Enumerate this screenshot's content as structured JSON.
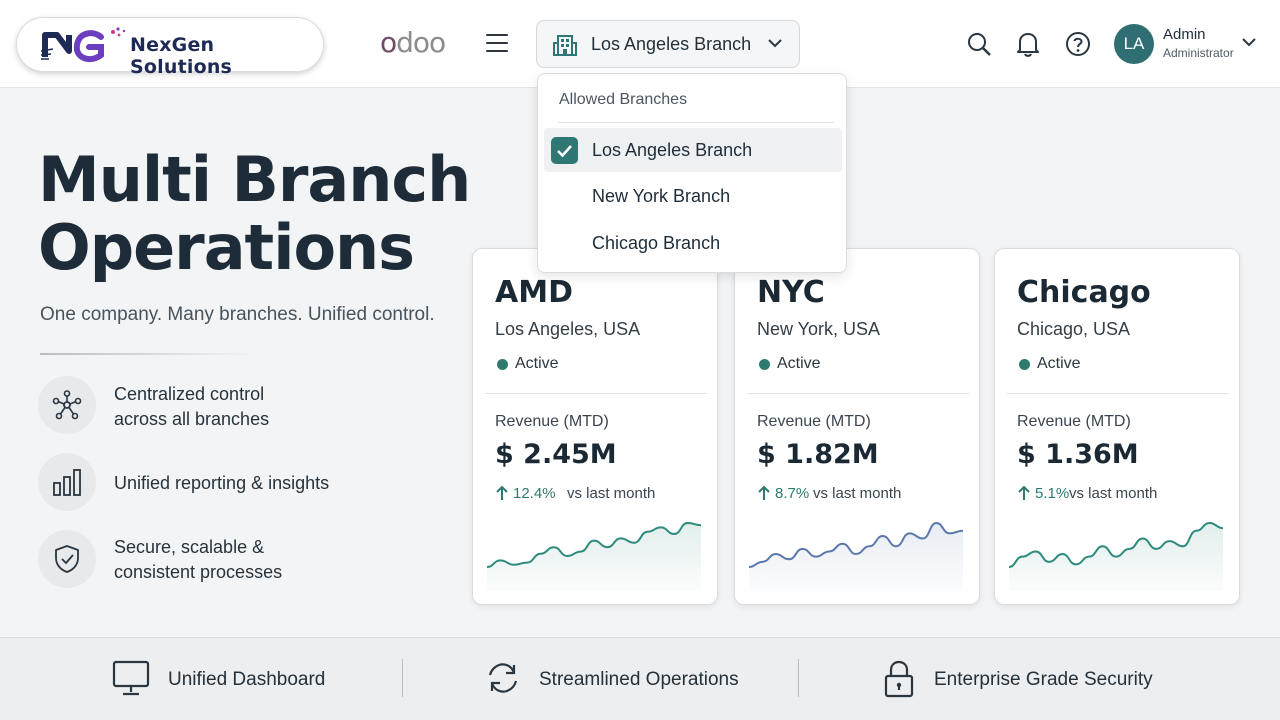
{
  "header": {
    "brand": "NexGen Solutions",
    "platform_logo": "odoo",
    "menu_icon": "hamburger-menu-icon",
    "branch_selector": {
      "icon": "building-icon",
      "value": "Los Angeles Branch"
    },
    "icons": [
      "search-icon",
      "bell-icon",
      "help-icon"
    ],
    "user": {
      "initials": "LA",
      "name": "Admin",
      "role": "Administrator"
    }
  },
  "branch_dropdown": {
    "heading": "Allowed Branches",
    "items": [
      {
        "label": "Los Angeles Branch",
        "checked": true
      },
      {
        "label": "New York Branch",
        "checked": false
      },
      {
        "label": "Chicago Branch",
        "checked": false
      }
    ]
  },
  "hero": {
    "title_line1": "Multi Branch",
    "title_line2": "Operations",
    "subtitle": "One company. Many branches. Unified control.",
    "features": [
      {
        "icon": "network-icon",
        "line1": "Centralized control",
        "line2": "across all branches"
      },
      {
        "icon": "bar-chart-icon",
        "line1": "Unified reporting & insights",
        "line2": ""
      },
      {
        "icon": "shield-check-icon",
        "line1": "Secure, scalable &",
        "line2": "consistent processes"
      }
    ]
  },
  "cards": [
    {
      "code": "AMD",
      "city": "Los Angeles, USA",
      "status": "Active",
      "rev_label": "Revenue (MTD)",
      "revenue": "$ 2.45M",
      "change": "12.4%",
      "vs": "vs last month",
      "line_color": "#2e8a7c",
      "spark": [
        10,
        13,
        11,
        12,
        16,
        19,
        15,
        17,
        22,
        19,
        23,
        21,
        26,
        28,
        25,
        30,
        29
      ]
    },
    {
      "code": "NYC",
      "city": "New York, USA",
      "status": "Active",
      "rev_label": "Revenue (MTD)",
      "revenue": "$ 1.82M",
      "change": "8.7%",
      "vs": "vs last month",
      "line_color": "#5b78ad",
      "spark": [
        10,
        12,
        15,
        13,
        17,
        14,
        16,
        19,
        15,
        18,
        22,
        18,
        23,
        21,
        27,
        23,
        24
      ]
    },
    {
      "code": "Chicago",
      "city": "Chicago, USA",
      "status": "Active",
      "rev_label": "Revenue (MTD)",
      "revenue": "$ 1.36M",
      "change": "5.1%",
      "vs": "vs last month",
      "line_color": "#2e8a7c",
      "spark": [
        10,
        14,
        16,
        12,
        15,
        11,
        14,
        18,
        14,
        17,
        21,
        17,
        20,
        18,
        24,
        27,
        25
      ]
    }
  ],
  "footer": [
    {
      "icon": "monitor-icon",
      "label": "Unified Dashboard"
    },
    {
      "icon": "refresh-icon",
      "label": "Streamlined Operations"
    },
    {
      "icon": "lock-icon",
      "label": "Enterprise Grade Security"
    }
  ],
  "colors": {
    "accent": "#2e7774",
    "positive": "#2e7a6f",
    "brand_navy": "#1c2a55",
    "brand_purple": "#7b3fbf"
  }
}
